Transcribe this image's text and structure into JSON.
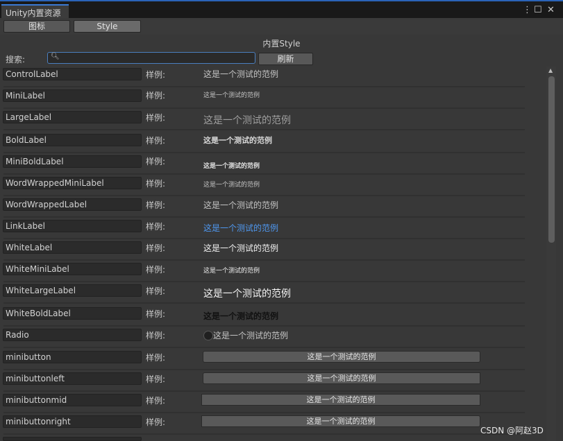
{
  "window": {
    "tab_title": "Unity内置资源",
    "menu_icon": "⋮",
    "maximize_icon": "☐",
    "close_icon": "✕"
  },
  "toolbar": {
    "icons_label": "图标",
    "style_label": "Style"
  },
  "section": {
    "title": "内置Style"
  },
  "search": {
    "label": "搜索:",
    "value": "",
    "placeholder": "",
    "icon": "magnifier-icon",
    "refresh_label": "刷新"
  },
  "example_label": "样例:",
  "sample_text": "这是一个测试的范例",
  "rows": [
    {
      "name": "ControlLabel",
      "example": "样例:",
      "sample": "这是一个测试的范例"
    },
    {
      "name": "MiniLabel",
      "example": "样例:",
      "sample": "这是一个测试的范例"
    },
    {
      "name": "LargeLabel",
      "example": "样例:",
      "sample": "这是一个测试的范例"
    },
    {
      "name": "BoldLabel",
      "example": "样例:",
      "sample": "这是一个测试的范例"
    },
    {
      "name": "MiniBoldLabel",
      "example": "样例:",
      "sample": "这是一个测试的范例"
    },
    {
      "name": "WordWrappedMiniLabel",
      "example": "样例:",
      "sample": "这是一个测试的范例"
    },
    {
      "name": "WordWrappedLabel",
      "example": "样例:",
      "sample": "这是一个测试的范例"
    },
    {
      "name": "LinkLabel",
      "example": "样例:",
      "sample": "这是一个测试的范例"
    },
    {
      "name": "WhiteLabel",
      "example": "样例:",
      "sample": "这是一个测试的范例"
    },
    {
      "name": "WhiteMiniLabel",
      "example": "样例:",
      "sample": "这是一个测试的范例"
    },
    {
      "name": "WhiteLargeLabel",
      "example": "样例:",
      "sample": "这是一个测试的范例"
    },
    {
      "name": "WhiteBoldLabel",
      "example": "样例:",
      "sample": "这是一个测试的范例"
    },
    {
      "name": "Radio",
      "example": "样例:",
      "sample": "这是一个测试的范例"
    },
    {
      "name": "minibutton",
      "example": "样例:",
      "sample": "这是一个测试的范例"
    },
    {
      "name": "minibuttonleft",
      "example": "样例:",
      "sample": "这是一个测试的范例"
    },
    {
      "name": "minibuttonmid",
      "example": "样例:",
      "sample": "这是一个测试的范例"
    },
    {
      "name": "minibuttonright",
      "example": "样例:",
      "sample": "这是一个测试的范例"
    }
  ],
  "watermark": "CSDN @阿赵3D"
}
